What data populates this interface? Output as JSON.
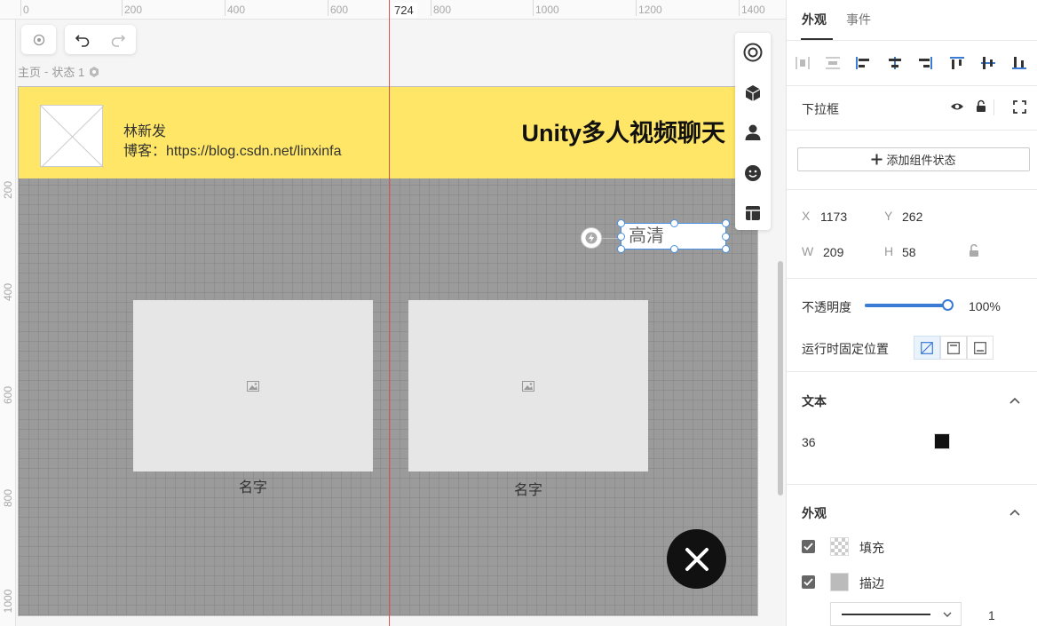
{
  "ruler": {
    "x_ticks": [
      "0",
      "200",
      "400",
      "600",
      "800",
      "1000",
      "1200",
      "1400"
    ],
    "y_ticks": [
      "200",
      "400",
      "600",
      "800",
      "1000"
    ],
    "cursor_label": "724"
  },
  "breadcrumb": {
    "page": "主页",
    "separator": " - ",
    "state": "状态 1"
  },
  "canvas": {
    "author_name": "林新发",
    "blog_label": "博客：",
    "blog_url": "https://blog.csdn.net/linxinfa",
    "app_title": "Unity多人视频聊天",
    "video_boxes": [
      {
        "caption": "名字"
      },
      {
        "caption": "名字"
      }
    ],
    "dropdown_text": "高清"
  },
  "panel": {
    "tabs": [
      "外观",
      "事件"
    ],
    "active_tab": "外观",
    "component_name": "下拉框",
    "add_state_label": "添加组件状态",
    "x_label": "X",
    "x_value": "1173",
    "y_label": "Y",
    "y_value": "262",
    "w_label": "W",
    "w_value": "209",
    "h_label": "H",
    "h_value": "58",
    "opacity_label": "不透明度",
    "opacity_value": "100%",
    "opacity_fraction": 1.0,
    "fixed_pos_label": "运行时固定位置",
    "text_section": "文本",
    "font_size": "36",
    "text_color": "#111111",
    "appearance_section": "外观",
    "fill_label": "填充",
    "stroke_label": "描边",
    "stroke_width": "1",
    "accent_color": "#4a90e2"
  }
}
